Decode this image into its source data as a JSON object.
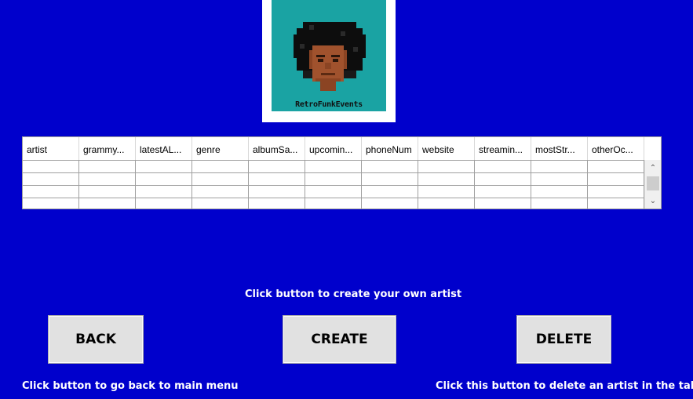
{
  "logo": {
    "text": "RetroFunkEvents",
    "bg_color": "#1aa3a3"
  },
  "table": {
    "columns": [
      "artist",
      "grammy...",
      "latestAL...",
      "genre",
      "albumSa...",
      "upcomin...",
      "phoneNum",
      "website",
      "streamin...",
      "mostStr...",
      "otherOc..."
    ],
    "rows": [
      [
        "",
        "",
        "",
        "",
        "",
        "",
        "",
        "",
        "",
        "",
        ""
      ],
      [
        "",
        "",
        "",
        "",
        "",
        "",
        "",
        "",
        "",
        "",
        ""
      ],
      [
        "",
        "",
        "",
        "",
        "",
        "",
        "",
        "",
        "",
        "",
        ""
      ],
      [
        "",
        "",
        "",
        "",
        "",
        "",
        "",
        "",
        "",
        "",
        ""
      ]
    ]
  },
  "buttons": {
    "back": "BACK",
    "create": "CREATE",
    "delete": "DELETE"
  },
  "labels": {
    "create_hint": "Click button to create your own artist",
    "back_hint": "Click button to go back to main menu",
    "delete_hint": "Click this button to delete an artist in the table"
  },
  "colors": {
    "background": "#0000CC",
    "button": "#e1e1e1",
    "text": "#ffffff"
  }
}
